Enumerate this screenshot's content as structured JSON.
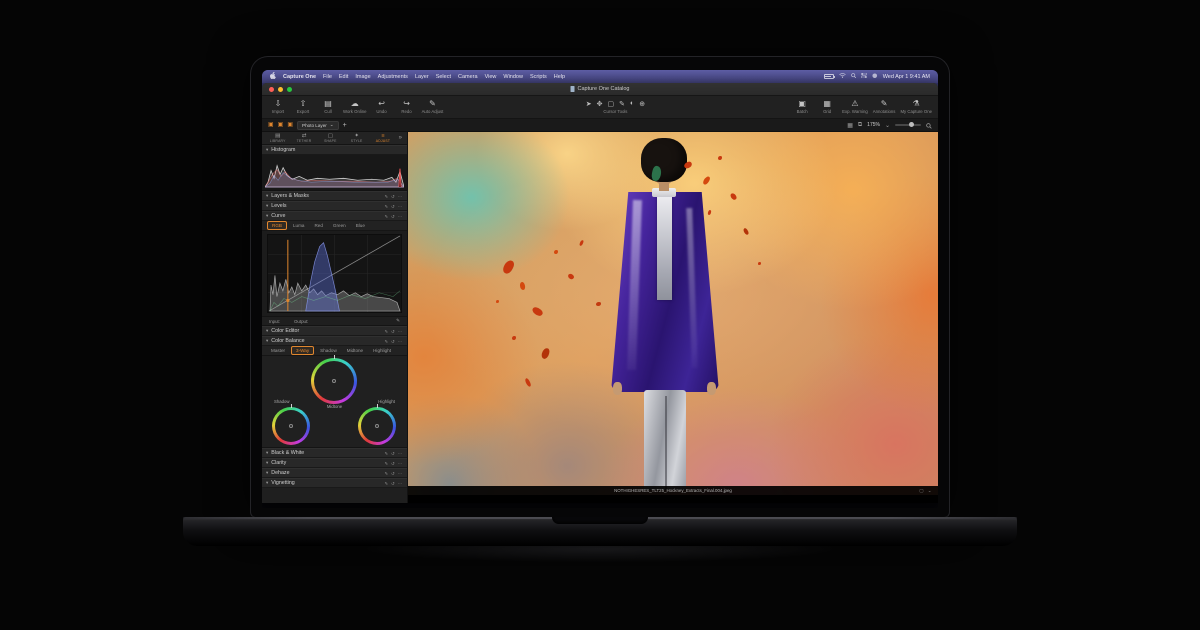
{
  "menu_bar": {
    "items": [
      "Capture One",
      "File",
      "Edit",
      "Image",
      "Adjustments",
      "Layer",
      "Select",
      "Camera",
      "View",
      "Window",
      "Scripts",
      "Help"
    ],
    "clock": "Wed Apr 1  9:41 AM"
  },
  "window": {
    "title": "Capture One Catalog"
  },
  "toolbar": {
    "left": [
      {
        "glyph": "⇩",
        "label": "Import"
      },
      {
        "glyph": "⇧",
        "label": "Export"
      },
      {
        "glyph": "▤",
        "label": "Cull"
      },
      {
        "glyph": "☁",
        "label": "Work Online"
      },
      {
        "glyph": "↩",
        "label": "Undo"
      },
      {
        "glyph": "↪",
        "label": "Redo"
      },
      {
        "glyph": "✎",
        "label": "Auto Adjust"
      }
    ],
    "cursor_tools": {
      "glyphs": [
        "➤",
        "✥",
        "▢",
        "✎",
        "◐",
        "⊕"
      ],
      "label": "Cursor Tools"
    },
    "right": [
      {
        "glyph": "▣",
        "label": "Batch"
      },
      {
        "glyph": "▦",
        "label": "Grid"
      },
      {
        "glyph": "⚠",
        "label": "Exp. Warning"
      },
      {
        "glyph": "✎",
        "label": "Annotations"
      },
      {
        "glyph": "⚗",
        "label": "My Capture One"
      }
    ]
  },
  "viewer_bar": {
    "layer_glyph": "▣",
    "layer_name": "Photo Layer",
    "dd_chevron": "⌄",
    "add_label": "+",
    "grid_glyph": "▦",
    "copy_glyph": "⧉",
    "zoom": "175%",
    "zoom_chevron": "⌄"
  },
  "sidebar": {
    "tabs": [
      {
        "glyph": "▤",
        "label": "LIBRARY"
      },
      {
        "glyph": "⇄",
        "label": "TETHER"
      },
      {
        "glyph": "▢",
        "label": "SHAPE"
      },
      {
        "glyph": "✦",
        "label": "STYLE"
      },
      {
        "glyph": "≡",
        "label": "ADJUST"
      }
    ],
    "more_glyph": "»",
    "disclosure_open": "▾",
    "header_icons": "✎ ↺ ⋯",
    "panels": {
      "histogram": "Histogram",
      "layers": "Layers & Masks",
      "levels": "Levels",
      "curve": "Curve",
      "color_editor": "Color Editor",
      "color_balance": "Color Balance",
      "bw": "Black & White",
      "clarity": "Clarity",
      "dehaze": "Dehaze",
      "vignetting": "Vignetting"
    },
    "curve": {
      "tabs": [
        "RGB",
        "Luma",
        "Red",
        "Green",
        "Blue"
      ],
      "input_label": "Input:",
      "output_label": "Output:",
      "pen_glyph": "✎"
    },
    "color_balance": {
      "tabs": [
        "Master",
        "3-Way",
        "Shadow",
        "Midtone",
        "Highlight"
      ],
      "wheel_labels": [
        "Shadow",
        "Midtone",
        "Highlight"
      ]
    }
  },
  "viewer": {
    "filename": "NOTHIGHESRES_TLT25_Hockney_Extracts_Final.004.jpeg",
    "corner_glyphs": "▢ ⌄"
  },
  "colors": {
    "accent": "#e0862e",
    "menubar_tint": "#50509a"
  }
}
